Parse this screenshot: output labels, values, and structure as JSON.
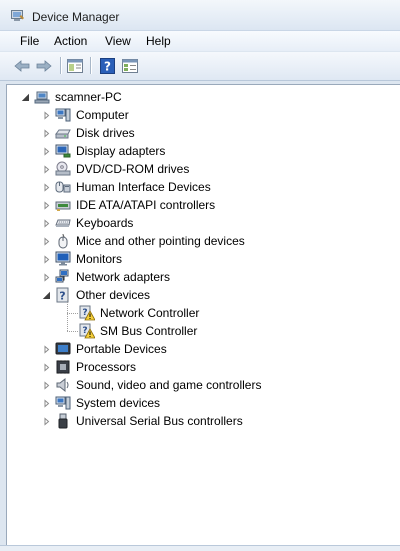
{
  "window": {
    "title": "Device Manager"
  },
  "menu": {
    "file": "File",
    "action": "Action",
    "view": "View",
    "help": "Help"
  },
  "toolbar": [
    "back-arrow-icon",
    "forward-arrow-icon",
    "show-hide-tree-icon",
    "help-icon",
    "properties-icon"
  ],
  "tree": {
    "root": "scamner-PC",
    "categories": [
      {
        "label": "Computer",
        "icon": "computer-icon",
        "expanded": false
      },
      {
        "label": "Disk drives",
        "icon": "disk-drive-icon",
        "expanded": false
      },
      {
        "label": "Display adapters",
        "icon": "display-adapter-icon",
        "expanded": false
      },
      {
        "label": "DVD/CD-ROM drives",
        "icon": "dvd-drive-icon",
        "expanded": false
      },
      {
        "label": "Human Interface Devices",
        "icon": "hid-icon",
        "expanded": false
      },
      {
        "label": "IDE ATA/ATAPI controllers",
        "icon": "ide-controller-icon",
        "expanded": false
      },
      {
        "label": "Keyboards",
        "icon": "keyboard-icon",
        "expanded": false
      },
      {
        "label": "Mice and other pointing devices",
        "icon": "mouse-icon",
        "expanded": false
      },
      {
        "label": "Monitors",
        "icon": "monitor-icon",
        "expanded": false
      },
      {
        "label": "Network adapters",
        "icon": "network-adapter-icon",
        "expanded": false
      },
      {
        "label": "Other devices",
        "icon": "unknown-device-icon",
        "expanded": true,
        "children": [
          {
            "label": "Network Controller",
            "icon": "warning-device-icon"
          },
          {
            "label": "SM Bus Controller",
            "icon": "warning-device-icon"
          }
        ]
      },
      {
        "label": "Portable Devices",
        "icon": "portable-device-icon",
        "expanded": false
      },
      {
        "label": "Processors",
        "icon": "processor-icon",
        "expanded": false
      },
      {
        "label": "Sound, video and game controllers",
        "icon": "speaker-icon",
        "expanded": false
      },
      {
        "label": "System devices",
        "icon": "system-devices-icon",
        "expanded": false
      },
      {
        "label": "Universal Serial Bus controllers",
        "icon": "usb-icon",
        "expanded": false
      }
    ]
  }
}
